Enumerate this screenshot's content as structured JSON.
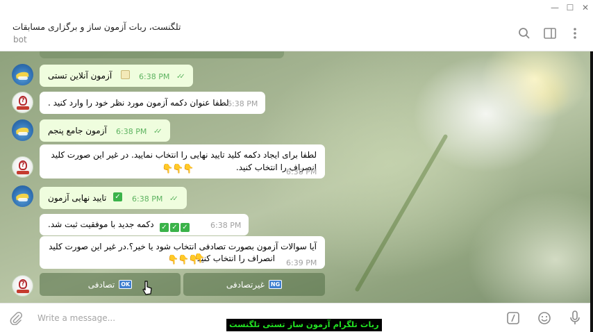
{
  "window": {
    "minimize": "—",
    "maximize": "☐",
    "close": "✕"
  },
  "header": {
    "title": "تلگنست، ربات آزمون ساز و برگزاری مسابقات",
    "subtitle": "bot"
  },
  "messages": [
    {
      "from": "user",
      "text": "آزمون آنلاین تستی",
      "emoji": "memo",
      "time": "6:38 PM",
      "read": true
    },
    {
      "from": "bot",
      "text": "لطفا عنوان دکمه آزمون مورد نظر خود را وارد کنید .",
      "time": "6:38 PM"
    },
    {
      "from": "user",
      "text": "آزمون جامع پنجم",
      "time": "6:38 PM",
      "read": true
    },
    {
      "from": "bot",
      "line1": "لطفا برای ایجاد دکمه کلید تایید نهایی را انتخاب نمایید. در غیر این صورت کلید",
      "line2": "انصراف را انتخاب کنید.",
      "time": "6:38 PM"
    },
    {
      "from": "user",
      "text": "تایید نهایی آزمون",
      "time": "6:38 PM",
      "read": true
    },
    {
      "from": "bot",
      "text": "دکمه جدید با موفقیت ثبت شد.",
      "time": "6:38 PM"
    },
    {
      "from": "bot",
      "line1": "آیا سوالات آزمون بصورت تصادفی انتخاب شود یا خیر؟.در غیر این صورت کلید",
      "line2": "انصراف را انتخاب کنید",
      "time": "6:39 PM"
    }
  ],
  "keyboard": {
    "random_label": "تصادفی",
    "random_tag": "OK",
    "nonrandom_label": "غیرتصادفی",
    "nonrandom_tag": "NG"
  },
  "input": {
    "placeholder": "Write a message..."
  },
  "caption": "ربات تلگرام آزمون ساز تستی تلگنست",
  "colors": {
    "outgoing_bubble": "#effdde",
    "incoming_bubble": "#ffffff",
    "caption_text": "#23e223"
  }
}
